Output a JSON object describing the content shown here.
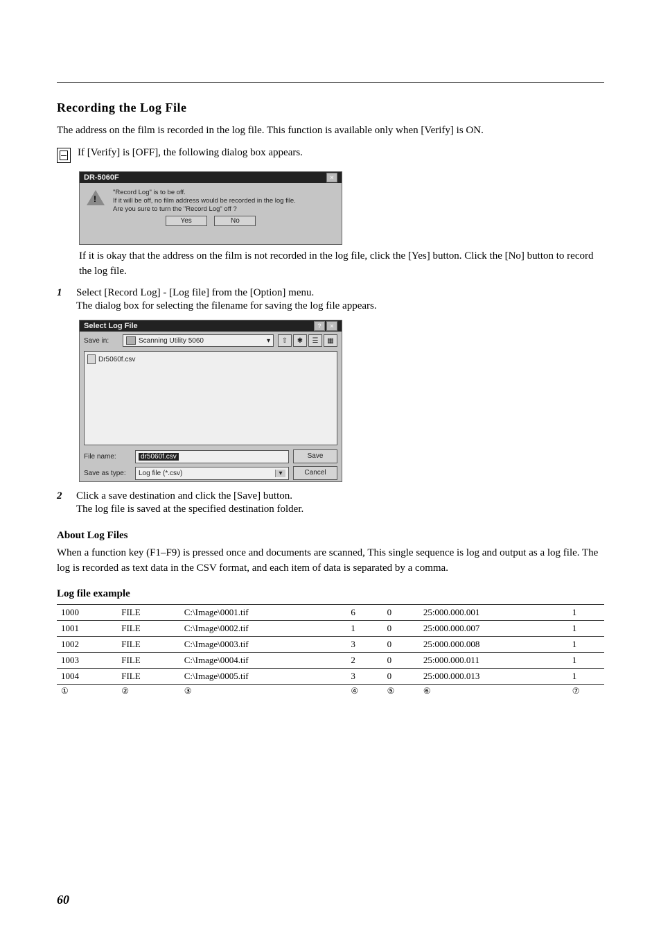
{
  "section_title": "Recording the Log File",
  "intro": "The address on the film is recorded in the log file. This function is available only when [Verify] is ON.",
  "icon_para_text": "If [Verify] is [OFF], the following dialog box appears.",
  "note_para": "If it is okay that the address on the film is not recorded in the log file, click the [Yes] button. Click the [No] button to record the log file.",
  "msgbox": {
    "title": "DR-5060F",
    "line1": "\"Record Log\" is to be off.",
    "line2": "If it will be off, no film address would be recorded in the log file.",
    "line3": "Are you sure to turn the \"Record Log\" off ?",
    "yes": "Yes",
    "no": "No"
  },
  "step1": {
    "num": "1",
    "text": "Select [Record Log] - [Log file] from the [Option] menu.",
    "sub": "The dialog box for selecting the filename for saving the log file appears."
  },
  "filedlg": {
    "title": "Select Log File",
    "save_in_label": "Save in:",
    "save_in_value": "Scanning Utility 5060",
    "existing_file": "Dr5060f.csv",
    "file_name_label": "File name:",
    "file_name_value": "dr5060f.csv",
    "type_label": "Save as type:",
    "type_value": "Log file (*.csv)",
    "save": "Save",
    "cancel": "Cancel"
  },
  "step2": {
    "num": "2",
    "text": "Click a save destination and click the [Save] button.",
    "sub": "The log file is saved at the specified destination folder."
  },
  "log_heading": "About Log Files",
  "log_body": "When a function key (F1–F9) is pressed once and documents are scanned, This single sequence is log and output as a log file. The log is recorded as text data in the CSV format, and each item of data is separated by a comma.",
  "log_example_heading": "Log file example",
  "log_rows": [
    [
      "1000",
      "FILE",
      "C:\\Image\\0001.tif",
      "6",
      "0",
      "25:000.000.001",
      "1"
    ],
    [
      "1001",
      "FILE",
      "C:\\Image\\0002.tif",
      "1",
      "0",
      "25:000.000.007",
      "1"
    ],
    [
      "1002",
      "FILE",
      "C:\\Image\\0003.tif",
      "3",
      "0",
      "25:000.000.008",
      "1"
    ],
    [
      "1003",
      "FILE",
      "C:\\Image\\0004.tif",
      "2",
      "0",
      "25:000.000.011",
      "1"
    ],
    [
      "1004",
      "FILE",
      "C:\\Image\\0005.tif",
      "3",
      "0",
      "25:000.000.013",
      "1"
    ]
  ],
  "log_refs": [
    "①",
    "②",
    "③",
    "④",
    "⑤",
    "⑥",
    "⑦"
  ],
  "page_number": "60"
}
